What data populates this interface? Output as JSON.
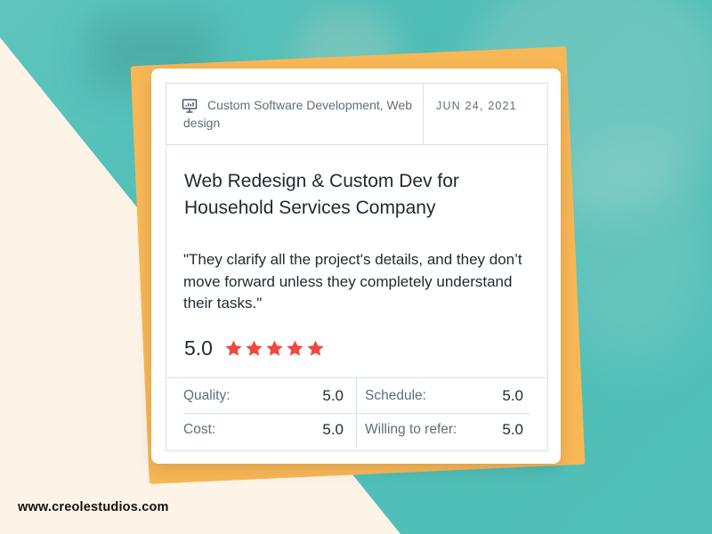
{
  "review": {
    "category": "Custom Software Development, Web design",
    "date": "JUN 24, 2021",
    "title": "Web Redesign & Custom Dev for Household Services Company",
    "quote": "\"They clarify all the project's details, and they don’t move forward unless they completely understand their tasks.\"",
    "overall_score": "5.0",
    "star_count": 5,
    "star_color": "#f0483e",
    "metrics": [
      {
        "label": "Quality:",
        "value": "5.0"
      },
      {
        "label": "Schedule:",
        "value": "5.0"
      },
      {
        "label": "Cost:",
        "value": "5.0"
      },
      {
        "label": "Willing to refer:",
        "value": "5.0"
      }
    ]
  },
  "footer": {
    "website": "www.creolestudios.com"
  },
  "colors": {
    "teal": "#4dbdb6",
    "cream": "#fdf3e7",
    "orange": "#f8b756"
  },
  "icons": {
    "category": "presentation-chart-icon",
    "star": "star-icon"
  }
}
